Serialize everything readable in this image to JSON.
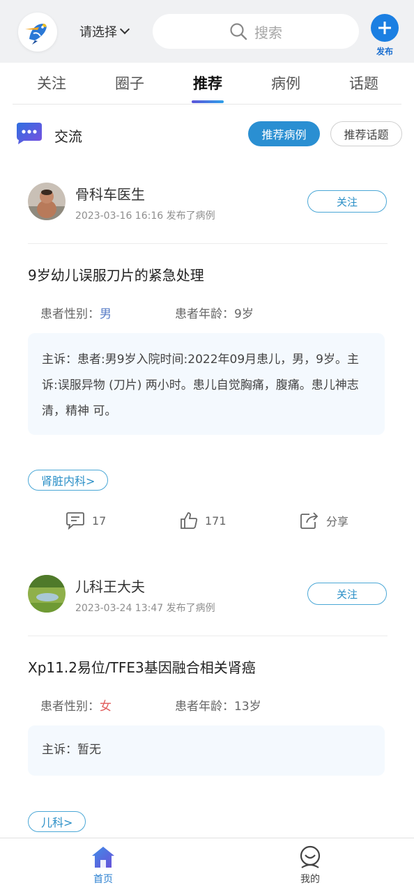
{
  "header": {
    "logo_icon": "woodpecker-logo-icon",
    "city_label": "请选择",
    "search_placeholder": "搜索",
    "publish_label": "发布"
  },
  "tabs": [
    {
      "label": "关注",
      "active": false
    },
    {
      "label": "圈子",
      "active": false
    },
    {
      "label": "推荐",
      "active": true
    },
    {
      "label": "病例",
      "active": false
    },
    {
      "label": "话题",
      "active": false
    }
  ],
  "section": {
    "title": "交流",
    "btn_cases": "推荐病例",
    "btn_topics": "推荐话题"
  },
  "posts": [
    {
      "author": "骨科车医生",
      "meta": "2023-03-16 16:16 发布了病例",
      "follow": "关注",
      "title": "9岁幼儿误服刀片的紧急处理",
      "gender_label": "患者性别：",
      "gender": "男",
      "age_label": "患者年龄：",
      "age": "9岁",
      "complaint": "主诉：患者:男9岁入院时间:2022年09月患儿，男，9岁。主诉:误服异物 (刀片) 两小时。患儿自觉胸痛，腹痛。患儿神志清，精神 可。",
      "tag": "肾脏内科>",
      "comments": "17",
      "likes": "171",
      "share": "分享"
    },
    {
      "author": "儿科王大夫",
      "meta": "2023-03-24 13:47 发布了病例",
      "follow": "关注",
      "title": "Xp11.2易位/TFE3基因融合相关肾癌",
      "gender_label": "患者性别：",
      "gender": "女",
      "age_label": "患者年龄：",
      "age": "13岁",
      "complaint": "主诉：暂无",
      "tag": "儿科>"
    }
  ],
  "bottom_nav": {
    "home": "首页",
    "me": "我的"
  },
  "colors": {
    "accent": "#2a8fd2",
    "publish": "#1b7fe2",
    "female": "#e15d5d",
    "male": "#5a7ec7"
  }
}
